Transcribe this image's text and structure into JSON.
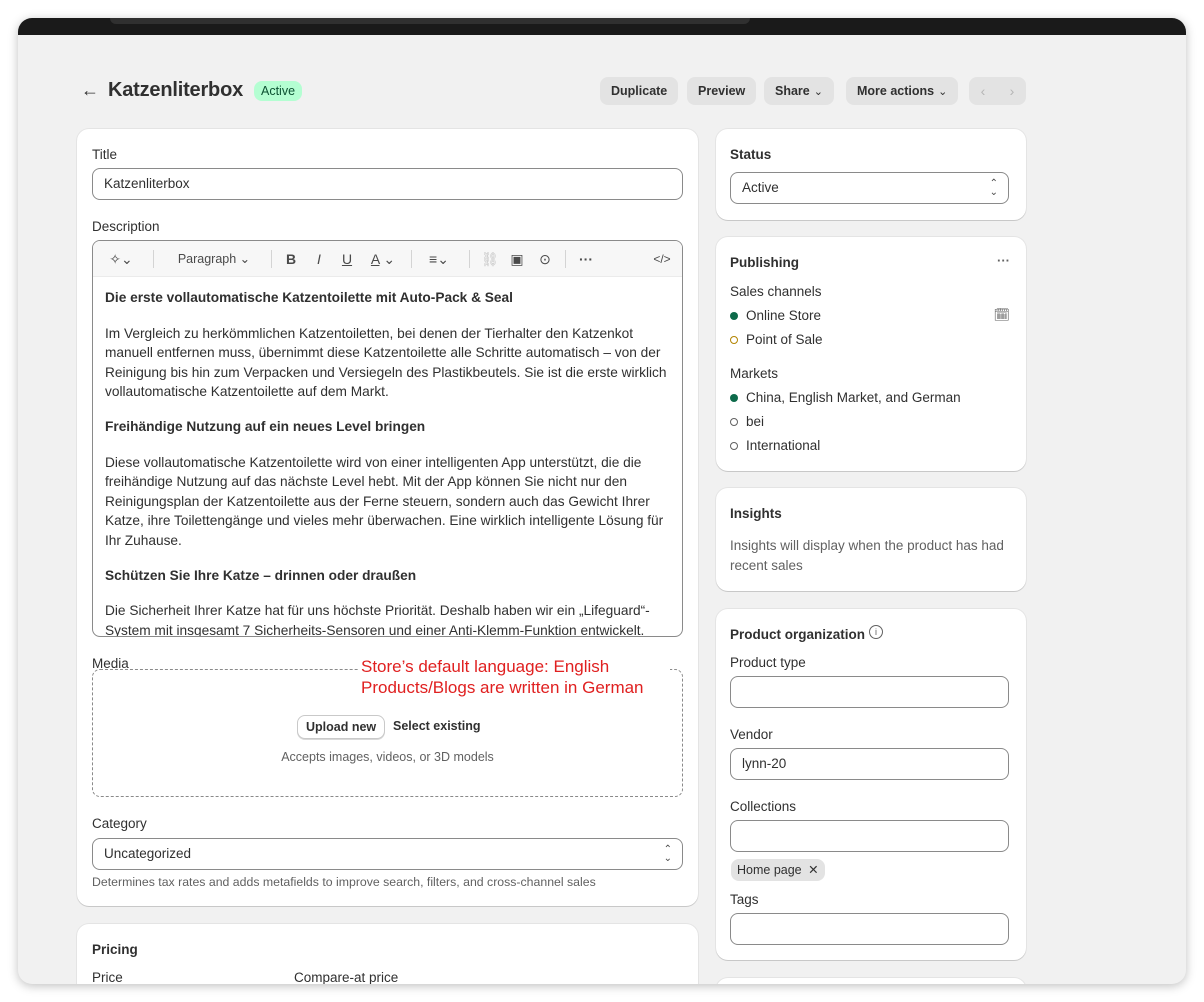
{
  "header": {
    "title": "Katzenliterbox",
    "status_badge": "Active",
    "buttons": {
      "duplicate": "Duplicate",
      "preview": "Preview",
      "share": "Share",
      "more_actions": "More actions"
    }
  },
  "main": {
    "title_label": "Title",
    "title_value": "Katzenliterbox",
    "description_label": "Description",
    "toolbar": {
      "paragraph": "Paragraph"
    },
    "description": {
      "h1": "Die erste vollautomatische Katzentoilette mit Auto-Pack & Seal",
      "p1": "Im Vergleich zu herkömmlichen Katzentoiletten, bei denen der Tierhalter den Katzenkot manuell entfernen muss, übernimmt diese Katzentoilette alle Schritte automatisch – von der Reinigung bis hin zum Verpacken und Versiegeln des Plastikbeutels. Sie ist die erste wirklich vollautomatische Katzentoilette auf dem Markt.",
      "h2": "Freihändige Nutzung auf ein neues Level bringen",
      "p2": "Diese vollautomatische Katzentoilette wird von einer intelligenten App unterstützt, die die freihändige Nutzung auf das nächste Level hebt. Mit der App können Sie nicht nur den Reinigungsplan der Katzentoilette aus der Ferne steuern, sondern auch das Gewicht Ihrer Katze, ihre Toilettengänge und vieles mehr überwachen. Eine wirklich intelligente Lösung für Ihr Zuhause.",
      "h3": "Schützen Sie Ihre Katze – drinnen oder draußen",
      "p3": "Die Sicherheit Ihrer Katze hat für uns höchste Priorität. Deshalb haben wir ein „Lifeguard“-System mit insgesamt 7 Sicherheits-Sensoren und einer Anti-Klemm-Funktion entwickelt."
    },
    "media_label": "Media",
    "upload_new": "Upload new",
    "select_existing": "Select existing",
    "accepts": "Accepts images, videos, or 3D models",
    "annotation_line1": "Store’s default language: English",
    "annotation_line2": "Products/Blogs are  written in German",
    "category_label": "Category",
    "category_value": "Uncategorized",
    "category_help": "Determines tax rates and adds metafields to improve search, filters, and cross-channel sales",
    "pricing_title": "Pricing",
    "price_label": "Price",
    "compare_label": "Compare-at price"
  },
  "sidebar": {
    "status_title": "Status",
    "status_value": "Active",
    "publishing_title": "Publishing",
    "sales_channels_label": "Sales channels",
    "sales_channels": [
      "Online Store",
      "Point of Sale"
    ],
    "markets_label": "Markets",
    "markets": [
      "China, English Market, and German",
      "bei",
      "International"
    ],
    "insights_title": "Insights",
    "insights_text": "Insights will display when the product has had recent sales",
    "org_title": "Product organization",
    "product_type_label": "Product type",
    "vendor_label": "Vendor",
    "vendor_value": "lynn-20",
    "collections_label": "Collections",
    "collection_pill": "Home page",
    "tags_label": "Tags"
  },
  "colors": {
    "badge_bg": "#b4fed2",
    "badge_text": "#0c5132",
    "annotation": "#e02020",
    "dot_green": "#0d6a4a",
    "dot_orange": "#b28400"
  }
}
